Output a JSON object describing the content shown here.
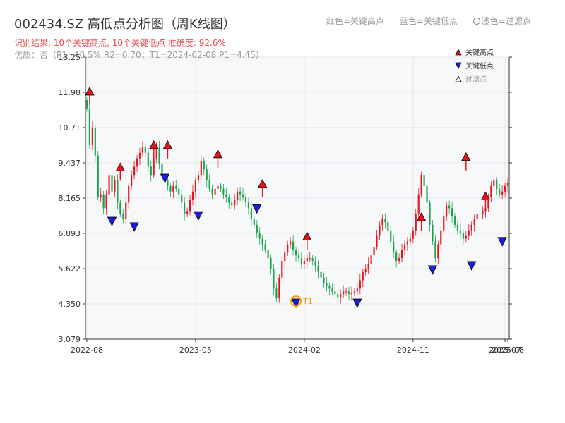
{
  "header": {
    "title": "002434.SZ 高低点分析图（周K线图）",
    "subtitle": "识别结果: 10个关键高点, 10个关键低点  准确度: 92.6%",
    "subtitle2": "优质：否（P1=40.5%  R2=0.70；T1=2024-02-08 P1=4.45）",
    "legend_top": [
      "红色=关键高点",
      "蓝色=关键低点",
      "浅色=过滤点"
    ]
  },
  "legend": {
    "high": "关键高点",
    "low": "关键低点",
    "filtered": "过滤点"
  },
  "colors": {
    "up": "#e8121c",
    "down": "#16a34a",
    "high_marker": "#e8121c",
    "low_marker": "#1c1cdc",
    "t1_ring": "#f59e0b",
    "plot_bg": "#f7f8fa",
    "grid": "#e3e6ea",
    "axis": "#333333"
  },
  "chart_data": {
    "type": "candlestick",
    "ylim": [
      3.079,
      13.25
    ],
    "yticks": [
      "3.079",
      "4.350",
      "5.622",
      "6.893",
      "8.165",
      "9.437",
      "10.71",
      "11.98",
      "13.25"
    ],
    "xticks": [
      "2022-08",
      "2023-05",
      "2024-02",
      "2024-11",
      "2025-07",
      "2025-08"
    ],
    "xtick_weeks": [
      0,
      39,
      78,
      117,
      150,
      151
    ],
    "week_count": 152,
    "closes": [
      11.4,
      10.1,
      10.7,
      9.7,
      8.2,
      8.3,
      7.8,
      8.3,
      9.0,
      8.4,
      8.8,
      8.0,
      7.6,
      7.4,
      8.0,
      8.6,
      9.0,
      9.3,
      9.6,
      9.8,
      10.0,
      9.8,
      9.3,
      9.0,
      9.6,
      10.0,
      9.4,
      9.0,
      8.8,
      8.6,
      8.4,
      8.6,
      8.5,
      8.3,
      8.0,
      7.6,
      7.7,
      8.1,
      8.4,
      8.8,
      9.0,
      9.5,
      9.2,
      8.8,
      8.5,
      8.3,
      8.5,
      8.6,
      8.5,
      8.3,
      8.2,
      8.0,
      7.9,
      8.1,
      8.4,
      8.3,
      8.2,
      8.0,
      7.8,
      7.4,
      7.2,
      6.9,
      6.7,
      6.5,
      6.3,
      6.0,
      5.6,
      4.9,
      4.55,
      5.3,
      5.9,
      6.2,
      6.5,
      6.6,
      6.3,
      6.1,
      6.0,
      5.8,
      5.9,
      6.0,
      6.0,
      5.9,
      5.7,
      5.5,
      5.3,
      5.1,
      5.0,
      4.9,
      4.8,
      4.7,
      4.6,
      4.7,
      4.8,
      4.8,
      4.7,
      4.75,
      4.8,
      4.9,
      5.2,
      5.5,
      5.6,
      5.8,
      6.1,
      6.4,
      6.8,
      7.2,
      7.4,
      7.3,
      7.0,
      6.6,
      6.2,
      5.9,
      6.0,
      6.3,
      6.5,
      6.6,
      6.7,
      7.0,
      7.6,
      8.3,
      9.0,
      8.6,
      8.0,
      7.2,
      6.6,
      6.0,
      6.5,
      7.0,
      7.5,
      7.9,
      7.8,
      7.5,
      7.2,
      7.0,
      6.9,
      6.7,
      6.8,
      7.0,
      7.2,
      7.4,
      7.6,
      7.6,
      7.7,
      7.8,
      8.2,
      8.6,
      8.8,
      8.5,
      8.3,
      8.4,
      8.6,
      8.7
    ],
    "key_highs": [
      {
        "week": 1,
        "price": 11.98
      },
      {
        "week": 12,
        "price": 9.25
      },
      {
        "week": 24,
        "price": 10.05
      },
      {
        "week": 29,
        "price": 10.05
      },
      {
        "week": 47,
        "price": 9.72
      },
      {
        "week": 63,
        "price": 8.65
      },
      {
        "week": 79,
        "price": 6.75
      },
      {
        "week": 120,
        "price": 7.45
      },
      {
        "week": 136,
        "price": 9.62
      },
      {
        "week": 143,
        "price": 8.2
      }
    ],
    "key_lows": [
      {
        "week": 9,
        "price": 7.35
      },
      {
        "week": 17,
        "price": 7.15
      },
      {
        "week": 28,
        "price": 8.9
      },
      {
        "week": 40,
        "price": 7.55
      },
      {
        "week": 61,
        "price": 7.8
      },
      {
        "week": 75,
        "price": 4.4
      },
      {
        "week": 97,
        "price": 4.4
      },
      {
        "week": 124,
        "price": 5.6
      },
      {
        "week": 138,
        "price": 5.75
      },
      {
        "week": 149,
        "price": 6.62
      }
    ],
    "t1": {
      "label": "T1",
      "week": 75,
      "price": 4.45
    }
  }
}
